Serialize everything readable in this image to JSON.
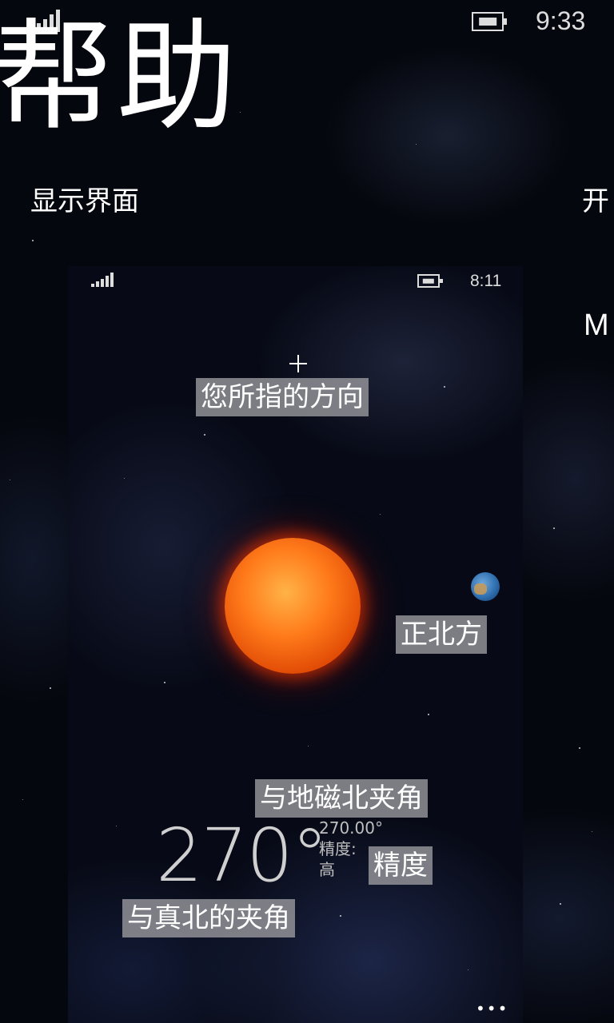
{
  "status_bar": {
    "time": "9:33"
  },
  "page": {
    "title": "帮助"
  },
  "pivot": {
    "active": "显示界面",
    "next": "开"
  },
  "right_peek_text": "M",
  "screenshot": {
    "status_time": "8:11",
    "labels": {
      "direction": "您所指的方向",
      "true_north_direction": "正北方",
      "magnetic_angle": "与地磁北夹角",
      "accuracy": "精度",
      "true_north_angle": "与真北的夹角"
    },
    "readout": {
      "angle": "270°",
      "magnetic_value": "270.00°",
      "accuracy_label": "精度:",
      "accuracy_value": "高"
    },
    "more": "•••"
  },
  "icons": [
    "signal-icon",
    "battery-icon",
    "sun",
    "earth",
    "sparkle-star"
  ]
}
